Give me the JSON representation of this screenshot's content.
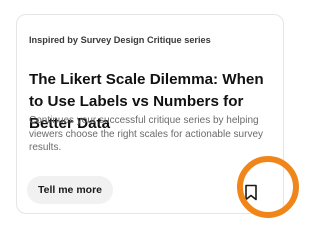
{
  "card": {
    "inspired_by": "Inspired by Survey Design Critique series",
    "title": "The Likert Scale Dilemma: When to Use Labels vs Numbers for Better Data",
    "description": "Continues your successful critique series by helping viewers choose the right scales for actionable survey results.",
    "more_button_label": "Tell me more",
    "bookmark_icon": "bookmark-outline-icon"
  },
  "highlight": {
    "color": "#f0861a"
  }
}
